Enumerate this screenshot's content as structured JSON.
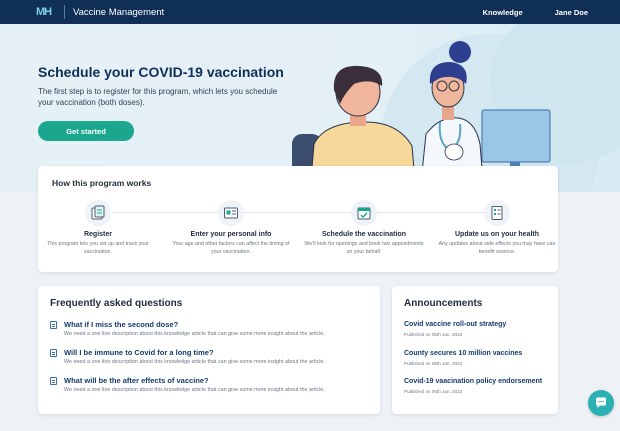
{
  "header": {
    "logo_text": "MH",
    "app_title": "Vaccine Management",
    "nav": [
      "Knowledge",
      "Jane Doe"
    ]
  },
  "hero": {
    "title": "Schedule your COVID-19 vaccination",
    "description": "The first step is to register for this program, which lets you schedule your vaccination (both doses).",
    "cta": "Get started"
  },
  "how": {
    "title": "How this program works",
    "steps": [
      {
        "icon": "register-icon",
        "title": "Register",
        "desc": "This program lets you set up and track your vaccination."
      },
      {
        "icon": "personal-info-icon",
        "title": "Enter your personal info",
        "desc": "Your age and other factors can affect the timing of your vaccination."
      },
      {
        "icon": "calendar-icon",
        "title": "Schedule the vaccination",
        "desc": "We'll look for openings and book two appointments on your behalf."
      },
      {
        "icon": "checklist-icon",
        "title": "Update us on your health",
        "desc": "Any updates about side effects you may have can benefit science."
      }
    ]
  },
  "faq": {
    "title": "Frequently asked questions",
    "items": [
      {
        "q": "What if I miss the second dose?",
        "a": "We need a one line description about this knowledge article that can give some more insight about the article."
      },
      {
        "q": "Will I be immune to Covid for a long time?",
        "a": "We need a one line description about this knowledge article that can give some more insight about the article."
      },
      {
        "q": "What will  be the after effects of vaccine?",
        "a": "We need a one line description about this knowledge article that can give some more insight about the article."
      }
    ]
  },
  "announcements": {
    "title": "Announcements",
    "items": [
      {
        "title": "Covid vaccine roll-out strategy",
        "date": "Published on 05th Jan, 2022"
      },
      {
        "title": "County secures 10 million vaccines",
        "date": "Published on 05th Jan, 2022"
      },
      {
        "title": "Covid-19 vaacination  policy endorsement",
        "date": "Published on 05th Jan, 2022"
      }
    ]
  },
  "colors": {
    "navbar": "#0f2f57",
    "accent": "#1aa78d",
    "link": "#153b6a",
    "chat": "#2bb0b4"
  }
}
